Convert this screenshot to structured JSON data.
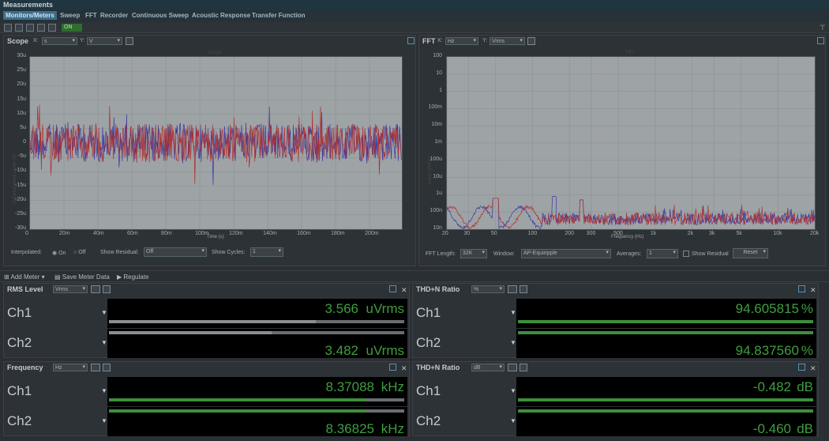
{
  "app": {
    "title": "Measurements"
  },
  "tabs": [
    {
      "label": "Monitors/Meters"
    },
    {
      "label": "Sweep"
    },
    {
      "label": "FFT"
    },
    {
      "label": "Recorder"
    },
    {
      "label": "Continuous Sweep"
    },
    {
      "label": "Acoustic Response"
    },
    {
      "label": "Transfer Function"
    }
  ],
  "toolbar": {
    "on_label": "ON"
  },
  "scope": {
    "title": "Scope",
    "x_label": "X:",
    "x_unit": "s",
    "y_label": "Y:",
    "y_unit": "V",
    "plot_title": "Scope",
    "y_axis_name": "Instantaneous Level (V)",
    "x_axis_name": "Time (s)",
    "y_ticks": [
      "30u",
      "25u",
      "20u",
      "15u",
      "10u",
      "5u",
      "0",
      "-5u",
      "-10u",
      "-15u",
      "-20u",
      "-25u",
      "-30u"
    ],
    "x_ticks": [
      "0",
      "20m",
      "40m",
      "60m",
      "80m",
      "100m",
      "120m",
      "140m",
      "160m",
      "180m",
      "200m"
    ],
    "interpolated_label": "Interpolated:",
    "on_label": "On",
    "off_label": "Off",
    "show_residual_label": "Show Residual:",
    "show_residual_value": "Off",
    "show_cycles_label": "Show Cycles:",
    "show_cycles_value": "1"
  },
  "fft": {
    "title": "FFT",
    "x_label": "X:",
    "x_unit": "Hz",
    "y_label": "Y:",
    "y_unit": "Vrms",
    "plot_title": "FFT",
    "y_axis_name": "Level (Vrms)",
    "x_axis_name": "Frequency (Hz)",
    "y_ticks": [
      "100",
      "10",
      "1",
      "100m",
      "10m",
      "1m",
      "100u",
      "10u",
      "1u",
      "100n",
      "10n"
    ],
    "x_ticks": [
      "20",
      "30",
      "50",
      "100",
      "200",
      "300",
      "500",
      "1k",
      "2k",
      "3k",
      "5k",
      "10k",
      "20k"
    ],
    "fft_length_label": "FFT Length:",
    "fft_length_value": "32K",
    "window_label": "Window:",
    "window_value": "AP-Equiripple",
    "averages_label": "Averages:",
    "averages_value": "1",
    "show_residual_label": "Show Residual",
    "reset_label": "Reset"
  },
  "meter_toolbar": {
    "add_meter": "Add Meter",
    "save_meter_data": "Save Meter Data",
    "regulate": "Regulate"
  },
  "meters": [
    {
      "title": "RMS Level",
      "unit_select": "Vrms",
      "channels": [
        {
          "name": "Ch1",
          "value": "3.566",
          "unit": "uVrms",
          "level": 0.7
        },
        {
          "name": "Ch2",
          "value": "3.482",
          "unit": "uVrms",
          "level": 0.55
        }
      ]
    },
    {
      "title": "THD+N Ratio",
      "unit_select": "%",
      "channels": [
        {
          "name": "Ch1",
          "value": "94.605815",
          "unit": "%",
          "level": 1.0
        },
        {
          "name": "Ch2",
          "value": "94.837560",
          "unit": "%",
          "level": 1.0
        }
      ]
    },
    {
      "title": "Frequency",
      "unit_select": "Hz",
      "channels": [
        {
          "name": "Ch1",
          "value": "8.37088",
          "unit": "kHz",
          "level": 0.87
        },
        {
          "name": "Ch2",
          "value": "8.36825",
          "unit": "kHz",
          "level": 0.87
        }
      ]
    },
    {
      "title": "THD+N Ratio",
      "unit_select": "dB",
      "channels": [
        {
          "name": "Ch1",
          "value": "-0.482",
          "unit": "dB",
          "level": 1.0
        },
        {
          "name": "Ch2",
          "value": "-0.460",
          "unit": "dB",
          "level": 1.0
        }
      ]
    }
  ],
  "colors": {
    "ch1_trace": "#b03030",
    "ch2_trace": "#3a3aa0",
    "meter_green": "#3f9e3f"
  }
}
